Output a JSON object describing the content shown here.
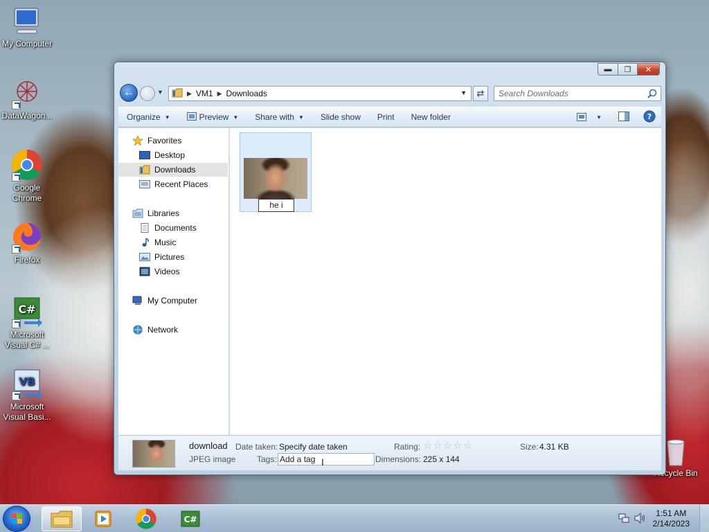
{
  "desktop": {
    "icons": [
      {
        "label": "My Computer"
      },
      {
        "label": "DataWagon..."
      },
      {
        "label": "Google Chrome"
      },
      {
        "label": "Firefox"
      },
      {
        "label": "Microsoft Visual C# ..."
      },
      {
        "label": "Microsoft Visual Basi..."
      },
      {
        "label": "Recycle Bin"
      }
    ]
  },
  "window": {
    "address": {
      "crumbs": [
        "VM1",
        "Downloads"
      ]
    },
    "search_placeholder": "Search Downloads",
    "toolbar": {
      "organize": "Organize",
      "preview": "Preview",
      "share_with": "Share with",
      "slide_show": "Slide show",
      "print": "Print",
      "new_folder": "New folder"
    },
    "nav": {
      "favorites": "Favorites",
      "desktop": "Desktop",
      "downloads": "Downloads",
      "recent_places": "Recent Places",
      "libraries": "Libraries",
      "documents": "Documents",
      "music": "Music",
      "pictures": "Pictures",
      "videos": "Videos",
      "my_computer": "My Computer",
      "network": "Network"
    },
    "file": {
      "rename_value": "he i"
    },
    "details": {
      "name": "download",
      "type": "JPEG image",
      "date_taken_label": "Date taken:",
      "date_taken_value": "Specify date taken",
      "tags_label": "Tags:",
      "tags_value": "Add a tag",
      "rating_label": "Rating:",
      "rating_value": 0,
      "dimensions_label": "Dimensions:",
      "dimensions_value": "225 x 144",
      "size_label": "Size:",
      "size_value": "4.31 KB"
    }
  },
  "taskbar": {
    "time": "1:51 AM",
    "date": "2/14/2023"
  }
}
